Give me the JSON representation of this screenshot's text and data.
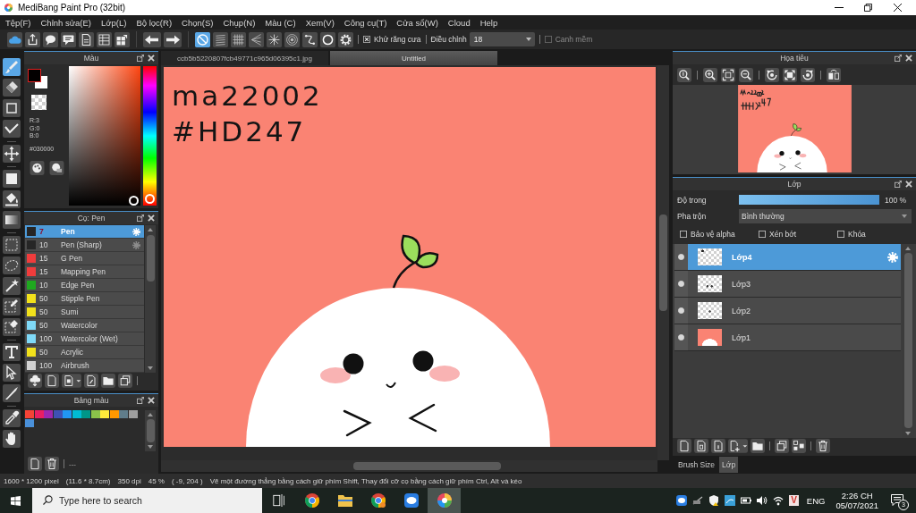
{
  "window": {
    "title": "MediBang Paint Pro (32bit)"
  },
  "menu": [
    "Tệp(F)",
    "Chỉnh sửa(E)",
    "Lớp(L)",
    "Bộ lọc(R)",
    "Chọn(S)",
    "Chụp(N)",
    "Màu (C)",
    "Xem(V)",
    "Công cụ(T)",
    "Cửa sổ(W)",
    "Cloud",
    "Help"
  ],
  "toolbar": {
    "snap_modes": [
      {
        "selected": true
      },
      {
        "selected": false
      },
      {
        "selected": false
      },
      {
        "selected": false
      },
      {
        "selected": false
      },
      {
        "selected": false
      },
      {
        "selected": false
      },
      {
        "selected": false
      },
      {
        "selected": false
      }
    ],
    "antialias": {
      "label": "Khử răng cưa",
      "checked": true
    },
    "correction": {
      "label": "Điều chỉnh",
      "value": "18"
    },
    "soft_edge": {
      "label": "Canh mềm",
      "checked": false
    }
  },
  "tools": [
    [
      {
        "selected": true
      },
      {
        "selected": false
      },
      {
        "selected": false
      },
      {
        "selected": false
      }
    ],
    [
      {
        "selected": false
      }
    ],
    [
      {
        "selected": false
      },
      {
        "selected": false
      },
      {
        "selected": false
      }
    ],
    [
      {
        "selected": false
      },
      {
        "selected": false
      },
      {
        "selected": false
      },
      {
        "selected": false
      },
      {
        "selected": false
      }
    ],
    [
      {
        "selected": false
      },
      {
        "selected": false
      },
      {
        "selected": false
      }
    ],
    [
      {
        "selected": false
      },
      {
        "selected": false
      }
    ]
  ],
  "color_panel": {
    "title": "Màu",
    "channels": [
      "R:3",
      "G:0",
      "B:0"
    ],
    "hex": "#030000",
    "hue": {
      "level": 0
    }
  },
  "brush_panel": {
    "title": "Cọ: Pen",
    "brushes": [
      {
        "size": "7",
        "name": "Pen",
        "color": "#262626",
        "selected": true,
        "hovered": false
      },
      {
        "size": "10",
        "name": "Pen (Sharp)",
        "color": "#262626",
        "selected": false,
        "hovered": true
      },
      {
        "size": "15",
        "name": "G Pen",
        "color": "#f03c3c",
        "selected": false,
        "hovered": false
      },
      {
        "size": "15",
        "name": "Mapping Pen",
        "color": "#f03c3c",
        "selected": false,
        "hovered": false
      },
      {
        "size": "10",
        "name": "Edge Pen",
        "color": "#1fa81f",
        "selected": false,
        "hovered": false
      },
      {
        "size": "50",
        "name": "Stipple Pen",
        "color": "#f2e11b",
        "selected": false,
        "hovered": false
      },
      {
        "size": "50",
        "name": "Sumi",
        "color": "#f2e11b",
        "selected": false,
        "hovered": false
      },
      {
        "size": "50",
        "name": "Watercolor",
        "color": "#7fd9f7",
        "selected": false,
        "hovered": false
      },
      {
        "size": "100",
        "name": "Watercolor (Wet)",
        "color": "#7fd9f7",
        "selected": false,
        "hovered": false
      },
      {
        "size": "50",
        "name": "Acrylic",
        "color": "#f2e11b",
        "selected": false,
        "hovered": false
      },
      {
        "size": "100",
        "name": "Airbrush",
        "color": "#d2d2d2",
        "selected": false,
        "hovered": false
      }
    ]
  },
  "palette_panel": {
    "title": "Bảng màu",
    "swatches": [
      {
        "color": "#f44336"
      },
      {
        "color": "#e91e63"
      },
      {
        "color": "#9c27b0"
      },
      {
        "color": "#3f51b5"
      },
      {
        "color": "#2196f3"
      },
      {
        "color": "#00bcd4"
      },
      {
        "color": "#009688"
      },
      {
        "color": "#8bc34a"
      },
      {
        "color": "#ffeb3b"
      },
      {
        "color": "#ff9800"
      },
      {
        "color": "#607d8b"
      },
      {
        "color": "#9e9e9e"
      },
      {
        "color": "#4a90d9"
      }
    ],
    "footer": "---"
  },
  "document_tabs": [
    {
      "label": "ccb5b5220807fcb49771c965d06395c1.jpg",
      "selected": false
    },
    {
      "label": "Untitled",
      "selected": true
    }
  ],
  "canvas": {
    "handwriting": [
      "ma22002",
      "#HD247"
    ]
  },
  "navigator": {
    "title": "Họa tiêu"
  },
  "layer_panel": {
    "title": "Lớp",
    "opacity": {
      "label": "Độ trong",
      "level": 1,
      "reading": "100 %"
    },
    "blend": {
      "label": "Pha trộn",
      "value": "Bình thường"
    },
    "options": [
      {
        "label": "Bảo vệ alpha",
        "checked": false
      },
      {
        "label": "Xén bớt",
        "checked": false
      },
      {
        "label": "Khóa",
        "checked": false
      }
    ],
    "layers": [
      {
        "name": "Lớp4",
        "selected": true,
        "visible": true
      },
      {
        "name": "Lớp3",
        "selected": false,
        "visible": true
      },
      {
        "name": "Lớp2",
        "selected": false,
        "visible": true
      },
      {
        "name": "Lớp1",
        "selected": false,
        "visible": true
      }
    ]
  },
  "panel_tabs": [
    {
      "label": "Brush Size",
      "selected": false
    },
    {
      "label": "Lớp",
      "selected": true
    }
  ],
  "status_bar": {
    "items": [
      "1600 * 1200 pixel",
      "(11.6 * 8.7cm)",
      "350 dpi",
      "45 %",
      "( -9, 204 )"
    ],
    "hint": "Vẽ một đường thẳng bằng cách giữ phím Shift, Thay đổi cỡ cọ bằng cách giữ phím Ctrl, Alt và kéo"
  },
  "taskbar": {
    "search": {
      "placeholder": "Type here to search"
    },
    "apps": [
      {
        "selected": false
      },
      {
        "selected": false
      },
      {
        "selected": false
      },
      {
        "selected": false
      },
      {
        "selected": false
      },
      {
        "selected": true
      }
    ],
    "input_method": "V",
    "language": "ENG",
    "time": "2:26 CH",
    "date": "05/07/2021",
    "notifications": "3"
  }
}
